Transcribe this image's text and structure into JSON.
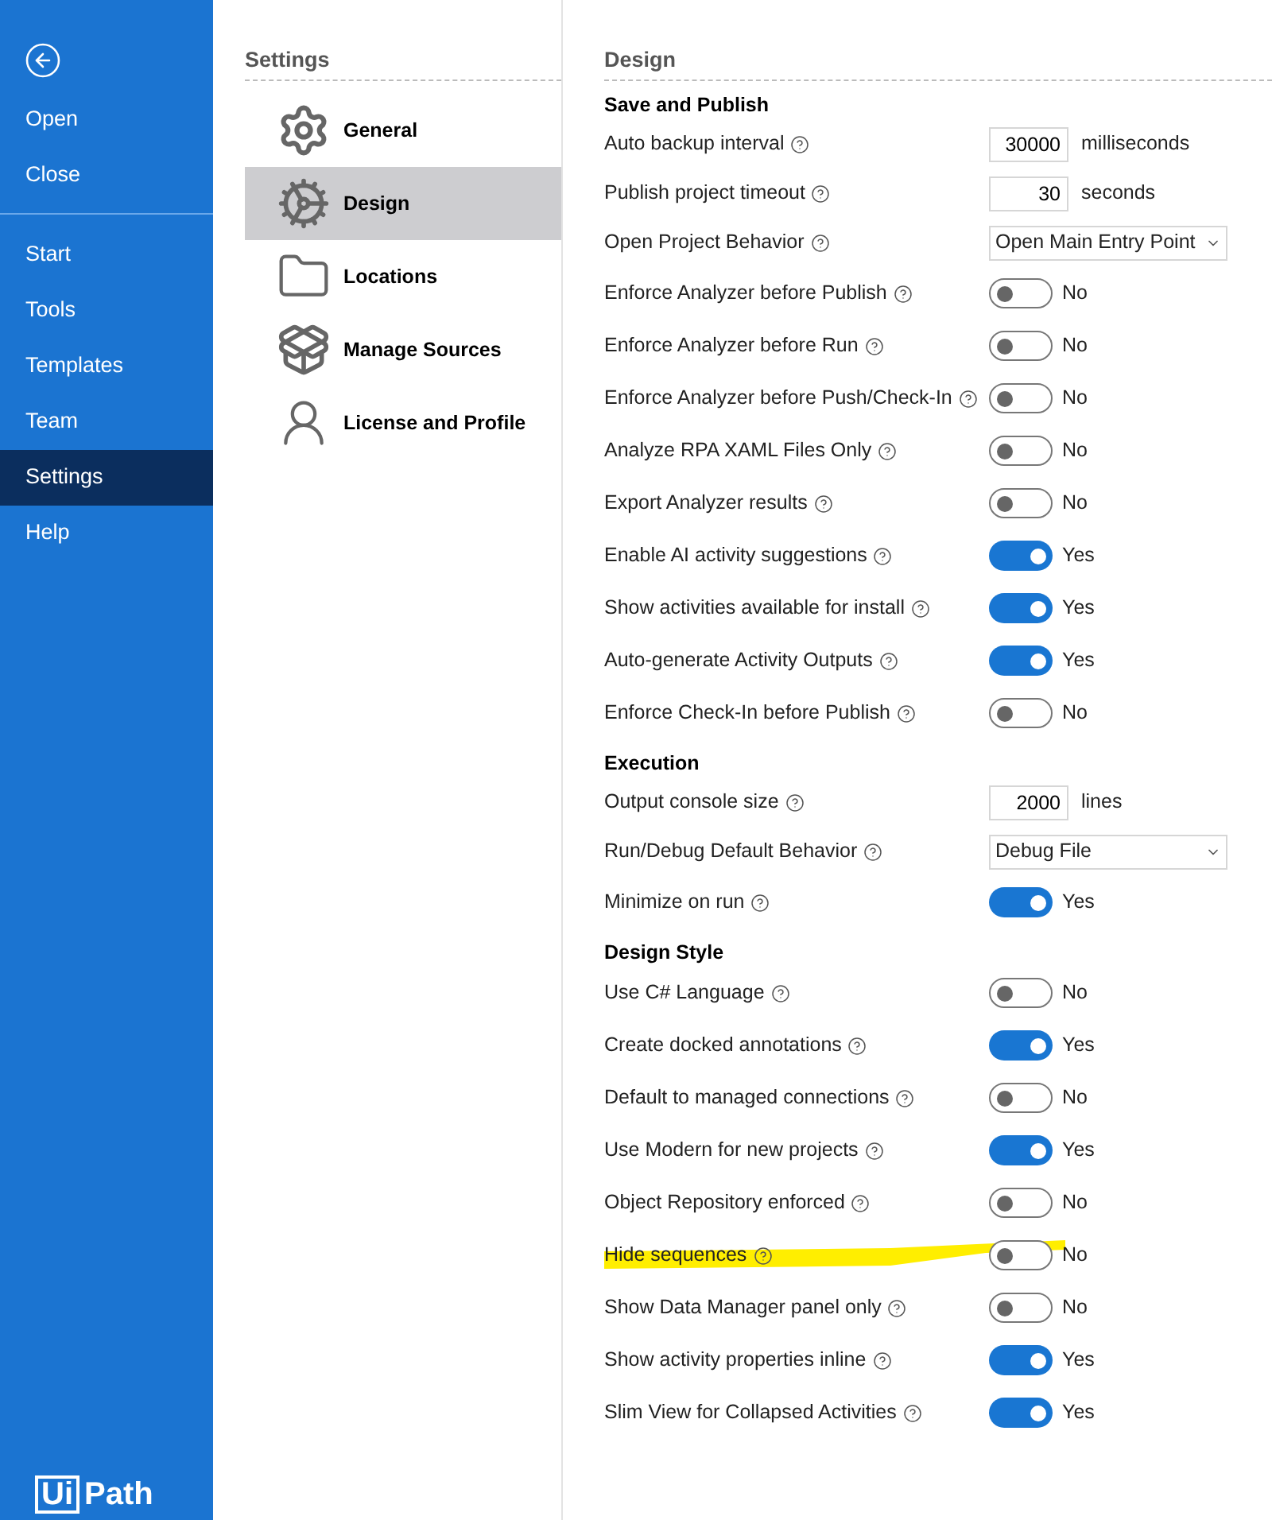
{
  "sidebar": {
    "groups": [
      [
        {
          "label": "Open",
          "selected": false
        },
        {
          "label": "Close",
          "selected": false
        }
      ],
      [
        {
          "label": "Start",
          "selected": false
        },
        {
          "label": "Tools",
          "selected": false
        },
        {
          "label": "Templates",
          "selected": false
        },
        {
          "label": "Team",
          "selected": false
        },
        {
          "label": "Settings",
          "selected": true
        },
        {
          "label": "Help",
          "selected": false
        }
      ]
    ],
    "logo": {
      "box_text": "Ui",
      "text": "Path"
    }
  },
  "categories": {
    "title": "Settings",
    "items": [
      {
        "label": "General",
        "kind": "general",
        "selected": false
      },
      {
        "label": "Design",
        "kind": "design",
        "selected": true
      },
      {
        "label": "Locations",
        "kind": "locations",
        "selected": false
      },
      {
        "label": "Manage Sources",
        "kind": "sources",
        "selected": false
      },
      {
        "label": "License and Profile",
        "kind": "license",
        "selected": false
      }
    ]
  },
  "panel": {
    "title": "Design",
    "sections": [
      {
        "title": "Save and Publish",
        "rows": [
          {
            "kind": "number",
            "label": "Auto backup interval",
            "value": "30000",
            "unit": "milliseconds"
          },
          {
            "kind": "number",
            "label": "Publish project timeout",
            "value": "30",
            "unit": "seconds"
          },
          {
            "kind": "select",
            "label": "Open Project Behavior",
            "value": "Open Main Entry Point"
          },
          {
            "kind": "toggle",
            "label": "Enforce Analyzer before Publish",
            "on": false,
            "state_text": "No"
          },
          {
            "kind": "toggle",
            "label": "Enforce Analyzer before Run",
            "on": false,
            "state_text": "No"
          },
          {
            "kind": "toggle",
            "label": "Enforce Analyzer before Push/Check-In",
            "on": false,
            "state_text": "No"
          },
          {
            "kind": "toggle",
            "label": "Analyze RPA XAML Files Only",
            "on": false,
            "state_text": "No"
          },
          {
            "kind": "toggle",
            "label": "Export Analyzer results",
            "on": false,
            "state_text": "No"
          },
          {
            "kind": "toggle",
            "label": "Enable AI activity suggestions",
            "on": true,
            "state_text": "Yes"
          },
          {
            "kind": "toggle",
            "label": "Show activities available for install",
            "on": true,
            "state_text": "Yes"
          },
          {
            "kind": "toggle",
            "label": "Auto-generate Activity Outputs",
            "on": true,
            "state_text": "Yes"
          },
          {
            "kind": "toggle",
            "label": "Enforce Check-In before Publish",
            "on": false,
            "state_text": "No"
          }
        ]
      },
      {
        "title": "Execution",
        "rows": [
          {
            "kind": "number",
            "label": "Output console size",
            "value": "2000",
            "unit": "lines"
          },
          {
            "kind": "select",
            "label": "Run/Debug Default Behavior",
            "value": "Debug File"
          },
          {
            "kind": "toggle",
            "label": "Minimize on run",
            "on": true,
            "state_text": "Yes"
          }
        ]
      },
      {
        "title": "Design Style",
        "rows": [
          {
            "kind": "toggle",
            "label": "Use C# Language",
            "on": false,
            "state_text": "No"
          },
          {
            "kind": "toggle",
            "label": "Create docked annotations",
            "on": true,
            "state_text": "Yes"
          },
          {
            "kind": "toggle",
            "label": "Default to managed connections",
            "on": false,
            "state_text": "No"
          },
          {
            "kind": "toggle",
            "label": "Use Modern for new projects",
            "on": true,
            "state_text": "Yes"
          },
          {
            "kind": "toggle",
            "label": "Object Repository enforced",
            "on": false,
            "state_text": "No"
          },
          {
            "kind": "toggle",
            "label": "Hide sequences",
            "on": false,
            "state_text": "No",
            "highlighted": true
          },
          {
            "kind": "toggle",
            "label": "Show Data Manager panel only",
            "on": false,
            "state_text": "No"
          },
          {
            "kind": "toggle",
            "label": "Show activity properties inline",
            "on": true,
            "state_text": "Yes"
          },
          {
            "kind": "toggle",
            "label": "Slim View for Collapsed Activities",
            "on": true,
            "state_text": "Yes"
          }
        ]
      }
    ]
  }
}
